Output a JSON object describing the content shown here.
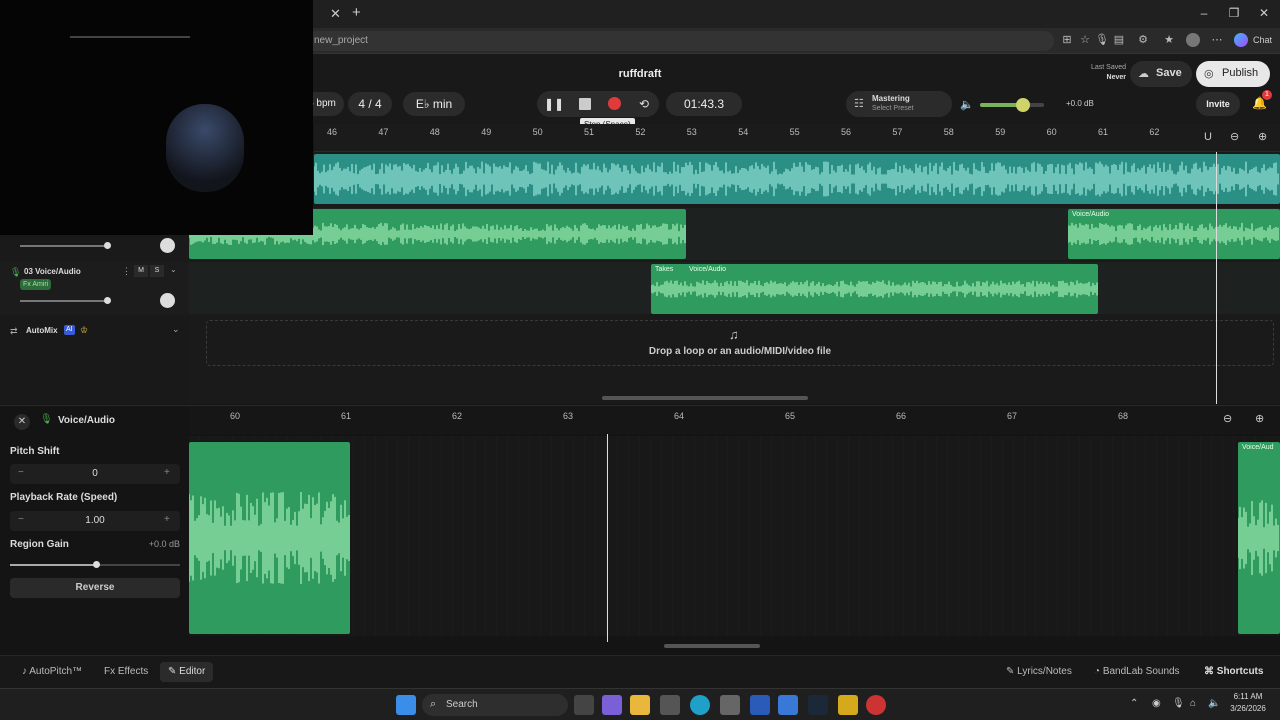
{
  "browser": {
    "url_text": "new_project",
    "chat_label": "Chat"
  },
  "header": {
    "project_title": "ruffdraft",
    "bpm_label": "5 bpm",
    "time_signature": "4 / 4",
    "key_label": "E♭ min",
    "time_display": "01:43.3",
    "tooltip": "Stop (Space)",
    "mastering_title": "Mastering",
    "mastering_preset": "Select Preset",
    "volume_db": "+0.0 dB",
    "last_saved_label": "Last Saved",
    "last_saved_value": "Never",
    "save_label": "Save",
    "publish_label": "Publish",
    "invite_label": "Invite",
    "notification_count": "1"
  },
  "ruler_top": [
    "46",
    "47",
    "48",
    "49",
    "50",
    "51",
    "52",
    "53",
    "54",
    "55",
    "56",
    "57",
    "58",
    "59",
    "60",
    "61",
    "62"
  ],
  "tracks": {
    "track3_name": "03  Voice/Audio",
    "track3_mute": "M",
    "track3_solo": "S",
    "track3_fx": "Fx Amiri",
    "clip_label_voice": "Voice/Audio",
    "clip_label_takes": "Takes",
    "automix_label": "AutoMix",
    "automix_ai": "AI",
    "drop_text": "Drop a loop or an audio/MIDI/video file"
  },
  "editor": {
    "title": "Voice/Audio",
    "pitch_label": "Pitch Shift",
    "pitch_value": "0",
    "rate_label": "Playback Rate (Speed)",
    "rate_value": "1.00",
    "gain_label": "Region Gain",
    "gain_value": "+0.0 dB",
    "reverse_label": "Reverse",
    "ruler": [
      "60",
      "61",
      "62",
      "63",
      "64",
      "65",
      "66",
      "67",
      "68"
    ],
    "clip_label": "Voice/Aud",
    "minus": "−",
    "plus": "+"
  },
  "bottombar": {
    "autopitch": "AutoPitch™",
    "effects": "Effects",
    "editor": "Editor",
    "lyrics": "Lyrics/Notes",
    "sounds": "BandLab Sounds",
    "shortcuts": "Shortcuts"
  },
  "taskbar": {
    "search_label": "Search",
    "time": "6:11 AM",
    "date": "3/26/2026"
  },
  "colors": {
    "teal_clip": "#2b8f86",
    "green_clip": "#2f9b5f",
    "record": "#e03b3b"
  }
}
